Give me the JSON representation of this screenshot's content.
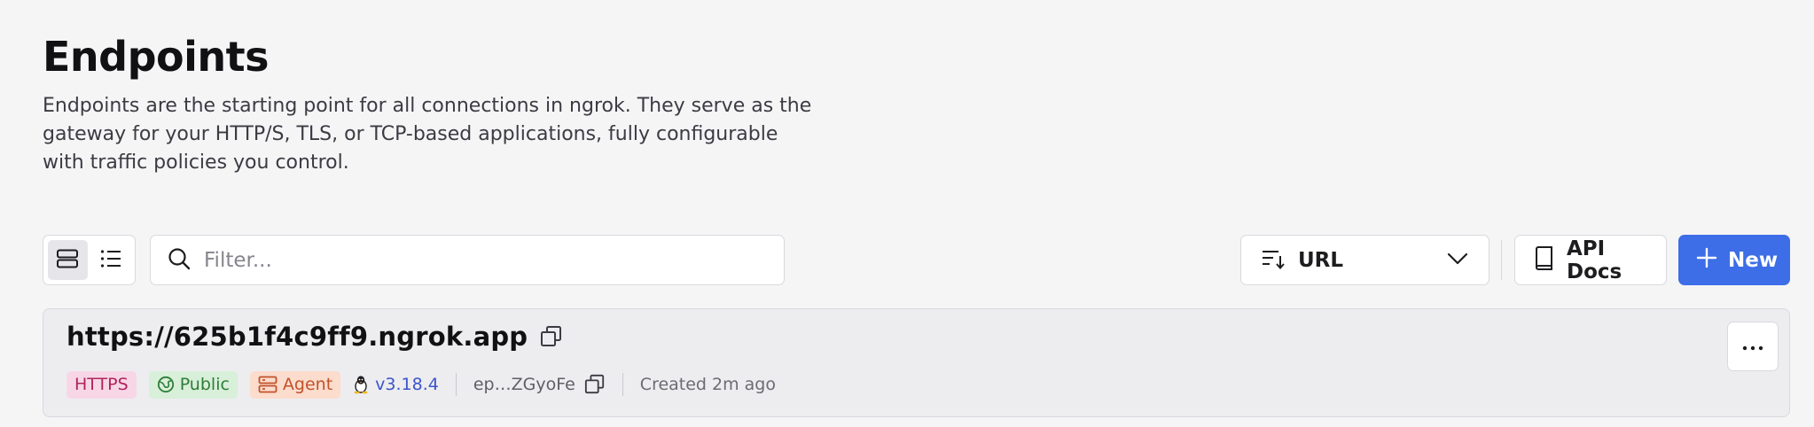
{
  "page": {
    "title": "Endpoints",
    "description": "Endpoints are the starting point for all connections in ngrok. They serve as the gateway for your HTTP/S, TLS, or TCP-based applications, fully configurable with traffic policies you control."
  },
  "toolbar": {
    "view_modes": [
      {
        "name": "card-view",
        "icon": "rows-icon",
        "active": true
      },
      {
        "name": "list-view",
        "icon": "list-icon",
        "active": false
      }
    ],
    "filter": {
      "placeholder": "Filter...",
      "value": ""
    },
    "sort": {
      "label": "URL"
    },
    "api_docs_label": "API Docs",
    "new_label": "New"
  },
  "endpoints": [
    {
      "url": "https://625b1f4c9ff9.ngrok.app",
      "protocol": "HTTPS",
      "visibility": "Public",
      "type": "Agent",
      "agent_version": "v3.18.4",
      "id": "ep…ZGyoFe",
      "created": "Created 2m ago"
    }
  ],
  "colors": {
    "accent": "#3d6ee8",
    "https_badge_bg": "#f7d7e6",
    "public_badge_bg": "#d8efd9",
    "agent_badge_bg": "#fbdccd"
  }
}
